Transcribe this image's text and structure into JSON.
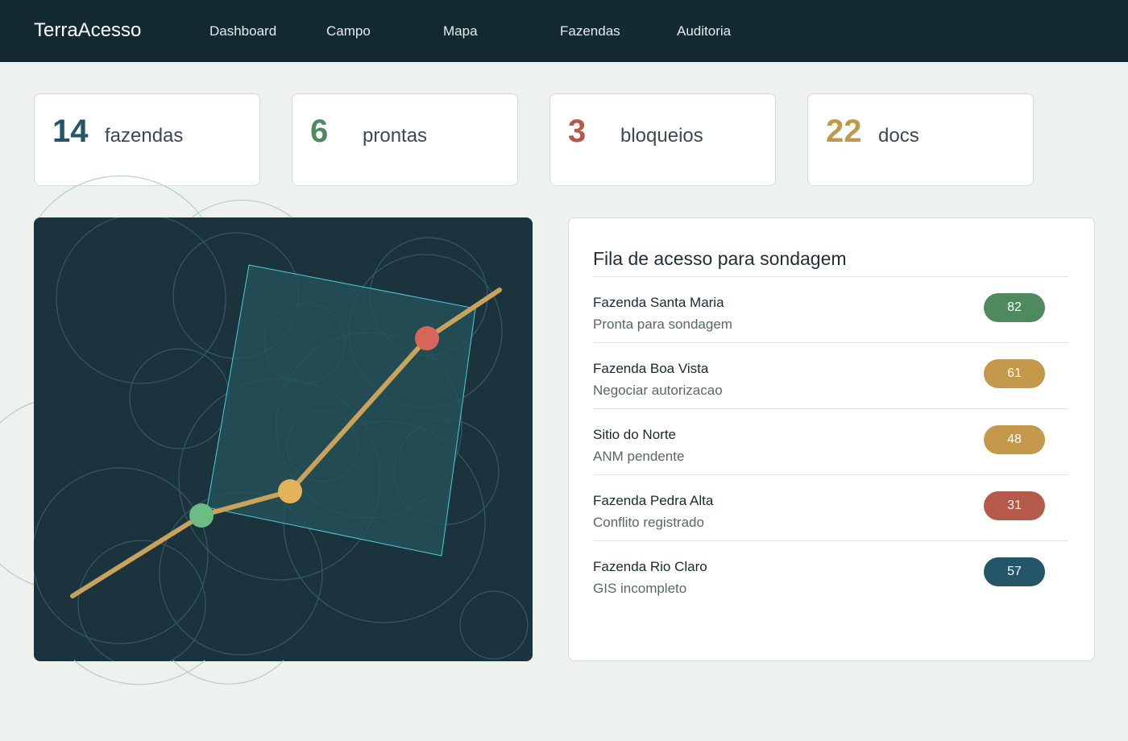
{
  "app": {
    "brand": "TerraAcesso"
  },
  "nav": {
    "items": [
      "Dashboard",
      "Campo",
      "Mapa",
      "Fazendas",
      "Auditoria"
    ]
  },
  "stats": [
    {
      "value": "14",
      "label": "fazendas",
      "color": "#24566a"
    },
    {
      "value": "6",
      "label": "prontas",
      "color": "#4f8a5f"
    },
    {
      "value": "3",
      "label": "bloqueios",
      "color": "#b55a4a"
    },
    {
      "value": "22",
      "label": "docs",
      "color": "#c4984a"
    }
  ],
  "queue": {
    "title": "Fila de acesso para sondagem",
    "rows": [
      {
        "name": "Fazenda Santa Maria",
        "status": "Pronta para sondagem",
        "score": "82",
        "color": "#4f8a5f"
      },
      {
        "name": "Fazenda Boa Vista",
        "status": "Negociar autorizacao",
        "score": "61",
        "color": "#c4984a"
      },
      {
        "name": "Sitio do Norte",
        "status": "ANM pendente",
        "score": "48",
        "color": "#c4984a"
      },
      {
        "name": "Fazenda Pedra Alta",
        "status": "Conflito registrado",
        "score": "31",
        "color": "#b55a4a"
      },
      {
        "name": "Fazenda Rio Claro",
        "status": "GIS incompleto",
        "score": "57",
        "color": "#24566a"
      }
    ]
  },
  "map": {
    "colors": {
      "background": "#1a333c",
      "polygon_fill": "#24515a",
      "polygon_stroke": "#4ecdd6",
      "route": "#c9a35a",
      "point_green": "#6bbd83",
      "point_yellow": "#e3b25a",
      "point_red": "#d7665a"
    }
  }
}
